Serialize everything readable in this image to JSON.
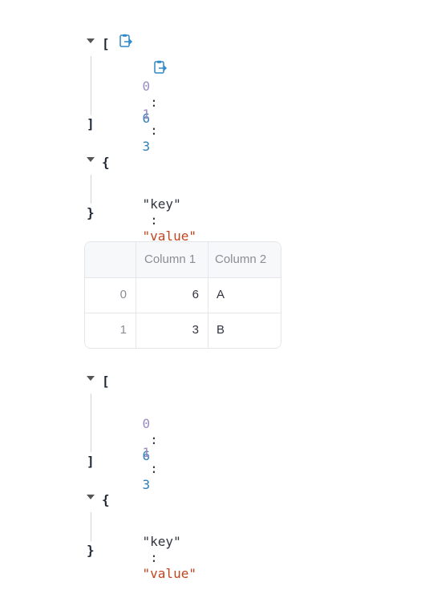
{
  "json_list_1": {
    "open": "[",
    "close": "]",
    "items": [
      {
        "index": "0",
        "value": "6"
      },
      {
        "index": "1",
        "value": "3"
      }
    ]
  },
  "json_obj_1": {
    "open": "{",
    "close": "}",
    "key": "\"key\"",
    "value": "\"value\""
  },
  "table": {
    "columns": [
      "",
      "Column 1",
      "Column 2"
    ],
    "rows": [
      {
        "index": "0",
        "col1": "6",
        "col2": "A"
      },
      {
        "index": "1",
        "col1": "3",
        "col2": "B"
      }
    ]
  },
  "json_list_2": {
    "open": "[",
    "close": "]",
    "items": [
      {
        "index": "0",
        "value": "6"
      },
      {
        "index": "1",
        "value": "3"
      }
    ]
  },
  "json_obj_2": {
    "open": "{",
    "close": "}",
    "key": "\"key\"",
    "value": "\"value\""
  },
  "colon": ":",
  "colors": {
    "index": "#9b8bc2",
    "number": "#2f7fb8",
    "string": "#c0451f",
    "copy_icon": "#2f88c8"
  },
  "icons": [
    "collapse-triangle-icon",
    "copy-to-clipboard-icon"
  ]
}
